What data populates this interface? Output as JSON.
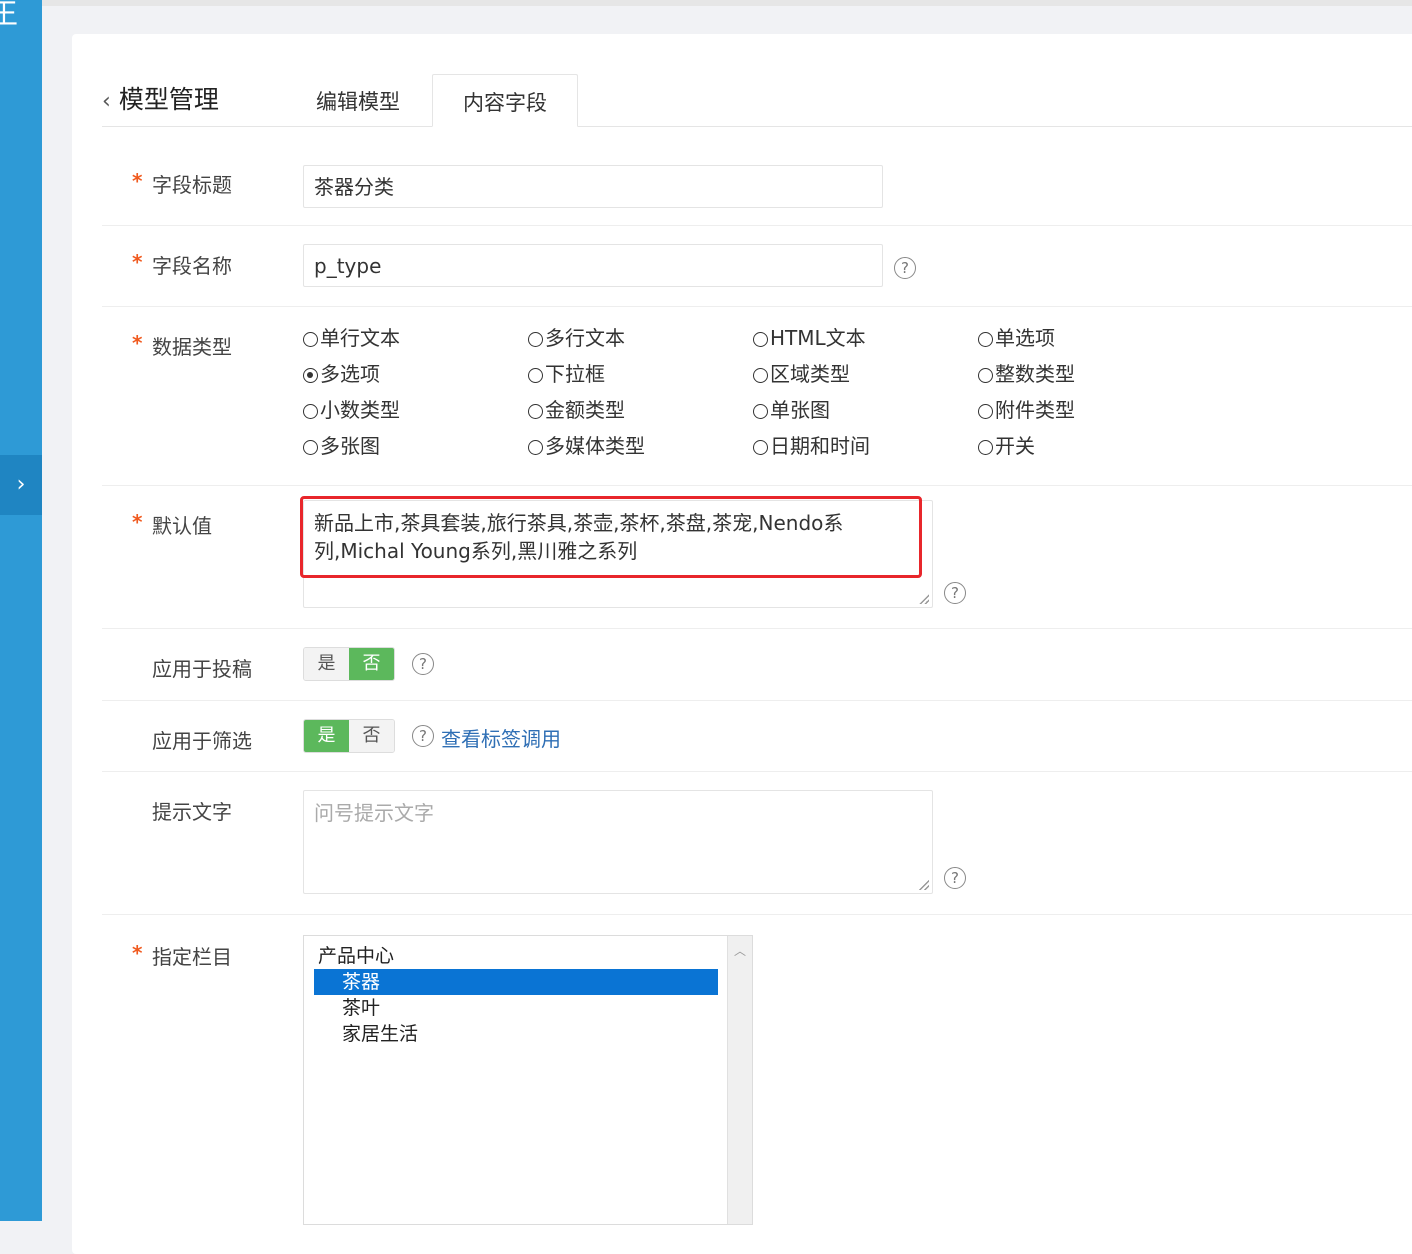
{
  "sidebar": {
    "top_glyph": "王",
    "toggle_icon": "chevron-right-icon"
  },
  "header": {
    "back_label": "模型管理",
    "tabs": [
      {
        "label": "编辑模型",
        "active": false
      },
      {
        "label": "内容字段",
        "active": true
      }
    ]
  },
  "form": {
    "field_title": {
      "label": "字段标题",
      "value": "茶器分类",
      "required": true
    },
    "field_name": {
      "label": "字段名称",
      "value": "p_type",
      "required": true
    },
    "data_type": {
      "label": "数据类型",
      "required": true,
      "options": [
        "单行文本",
        "多行文本",
        "HTML文本",
        "单选项",
        "多选项",
        "下拉框",
        "区域类型",
        "整数类型",
        "小数类型",
        "金额类型",
        "单张图",
        "附件类型",
        "多张图",
        "多媒体类型",
        "日期和时间",
        "开关"
      ],
      "selected": "多选项"
    },
    "default_value": {
      "label": "默认值",
      "required": true,
      "value": "新品上市,茶具套装,旅行茶具,茶壶,茶杯,茶盘,茶宠,Nendo系列,Michal Young系列,黑川雅之系列"
    },
    "apply_submit": {
      "label": "应用于投稿",
      "yes": "是",
      "no": "否",
      "value": "否"
    },
    "apply_filter": {
      "label": "应用于筛选",
      "yes": "是",
      "no": "否",
      "value": "是",
      "link": "查看标签调用"
    },
    "hint_text": {
      "label": "提示文字",
      "placeholder": "问号提示文字"
    },
    "category": {
      "label": "指定栏目",
      "required": true,
      "options": [
        {
          "label": "产品中心",
          "indent": 0,
          "selected": false
        },
        {
          "label": "茶器",
          "indent": 1,
          "selected": true
        },
        {
          "label": "茶叶",
          "indent": 1,
          "selected": false
        },
        {
          "label": "家居生活",
          "indent": 1,
          "selected": false
        }
      ]
    },
    "required_mark": "*",
    "help_glyph": "?"
  },
  "colors": {
    "sidebar": "#2e9ad6",
    "accent_green": "#5cb85c",
    "highlight_red": "#e8262b",
    "link": "#2f6fb5",
    "selected_option": "#0a74d4"
  }
}
